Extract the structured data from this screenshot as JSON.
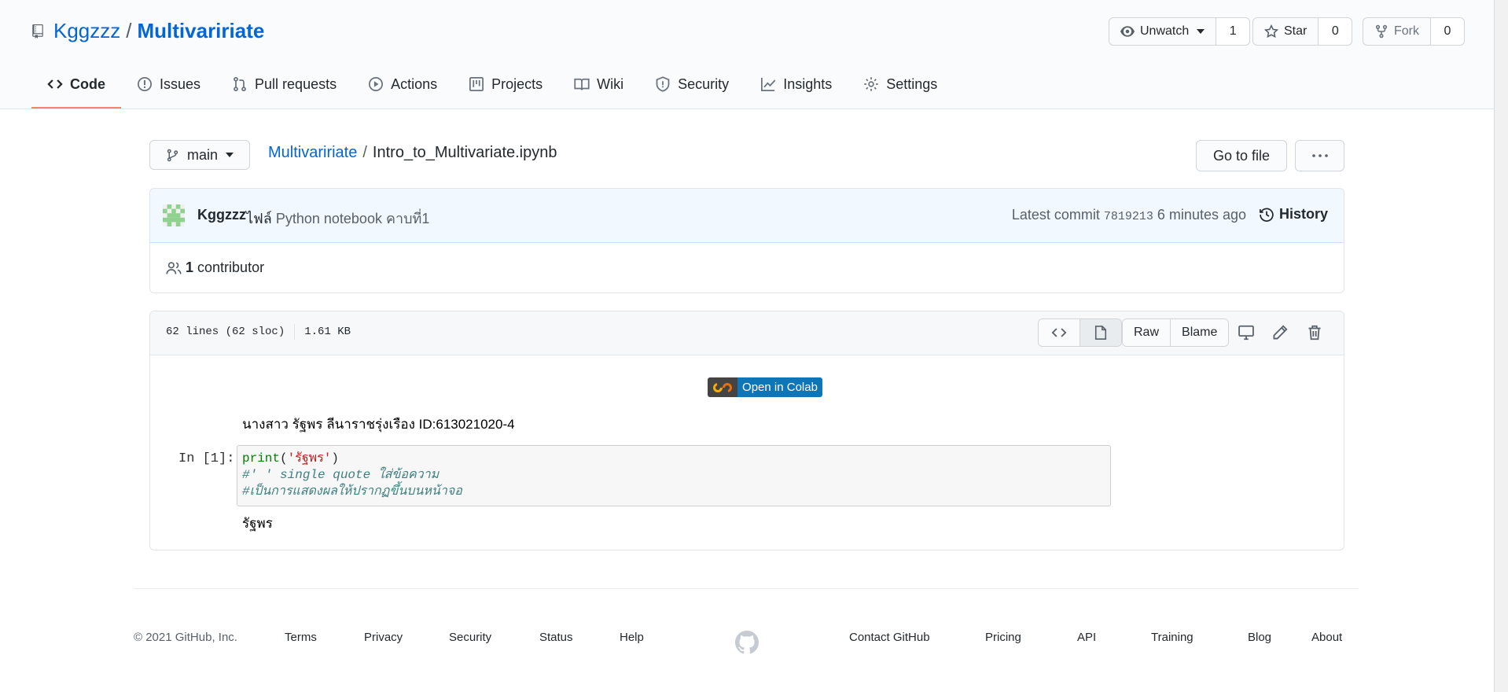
{
  "repo": {
    "owner": "Kggzzz",
    "separator": "/",
    "name": "Multivaririate"
  },
  "actions": {
    "watch": {
      "label": "Unwatch",
      "count": "1"
    },
    "star": {
      "label": "Star",
      "count": "0"
    },
    "fork": {
      "label": "Fork",
      "count": "0"
    }
  },
  "tabs": [
    {
      "label": "Code",
      "icon": "code-icon",
      "active": true
    },
    {
      "label": "Issues",
      "icon": "issue-icon"
    },
    {
      "label": "Pull requests",
      "icon": "pull-request-icon"
    },
    {
      "label": "Actions",
      "icon": "play-icon"
    },
    {
      "label": "Projects",
      "icon": "project-icon"
    },
    {
      "label": "Wiki",
      "icon": "book-icon"
    },
    {
      "label": "Security",
      "icon": "shield-icon"
    },
    {
      "label": "Insights",
      "icon": "graph-icon"
    },
    {
      "label": "Settings",
      "icon": "gear-icon"
    }
  ],
  "file_nav": {
    "branch": "main",
    "breadcrumb_repo": "Multivaririate",
    "breadcrumb_sep": "/",
    "file_name": "Intro_to_Multivariate.ipynb",
    "go_to_file": "Go to file",
    "more": "···"
  },
  "commit": {
    "author": "Kggzzz",
    "message_prefix": "ไฟล์",
    "message": "Python notebook คาบที่1",
    "latest_label": "Latest commit",
    "sha": "7819213",
    "time": "6 minutes ago",
    "history": "History",
    "contributors_count": "1",
    "contributors_label": "contributor"
  },
  "file": {
    "lines": "62 lines (62 sloc)",
    "size": "1.61 KB",
    "raw": "Raw",
    "blame": "Blame"
  },
  "notebook": {
    "colab_badge": "Open in Colab",
    "markdown": "นางสาว รัฐพร ลีนาราชรุ่งเรือง ID:613021020-4",
    "prompt": "In [1]:",
    "code_fn": "print",
    "code_open": "(",
    "code_str": "'รัฐพร'",
    "code_close": ")",
    "comment1": "#' ' single quote ใส่ข้อความ",
    "comment2": "#เป็นการแสดงผลให้ปรากฏขึ้นบนหน้าจอ",
    "output": "รัฐพร"
  },
  "footer": {
    "copyright": "© 2021 GitHub, Inc.",
    "links_left": [
      "Terms",
      "Privacy",
      "Security",
      "Status",
      "Help"
    ],
    "links_right": [
      "Contact GitHub",
      "Pricing",
      "API",
      "Training",
      "Blog",
      "About"
    ]
  },
  "colors": {
    "link": "#0366d6",
    "tab_underline": "#f9826c",
    "commit_bg": "#f1f8ff",
    "colab_blue": "#0e75b6"
  }
}
